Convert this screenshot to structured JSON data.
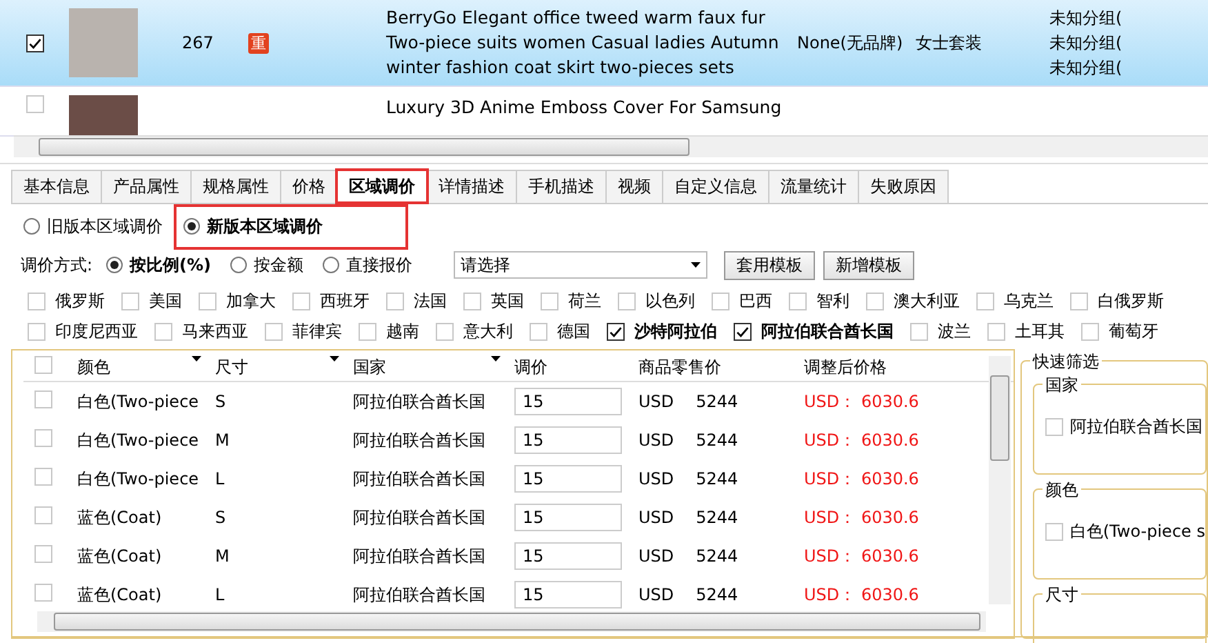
{
  "products": [
    {
      "checked": true,
      "selected": true,
      "id": "267",
      "badge": "重",
      "title": "BerryGo Elegant office tweed warm faux fur Two-piece suits women Casual ladies Autumn winter fashion coat skirt two-pieces sets",
      "brand": "None(无品牌)",
      "category": "女士套装",
      "groups": [
        "未知分组(",
        "未知分组(",
        "未知分组("
      ]
    },
    {
      "checked": false,
      "selected": false,
      "title": "Luxury 3D Anime Emboss Cover For Samsung"
    }
  ],
  "tabs": [
    {
      "label": "基本信息",
      "selected": false
    },
    {
      "label": "产品属性",
      "selected": false
    },
    {
      "label": "规格属性",
      "selected": false
    },
    {
      "label": "价格",
      "selected": false
    },
    {
      "label": "区域调价",
      "selected": true
    },
    {
      "label": "详情描述",
      "selected": false
    },
    {
      "label": "手机描述",
      "selected": false
    },
    {
      "label": "视频",
      "selected": false
    },
    {
      "label": "自定义信息",
      "selected": false
    },
    {
      "label": "流量统计",
      "selected": false
    },
    {
      "label": "失败原因",
      "selected": false
    }
  ],
  "versions": [
    {
      "label": "旧版本区域调价",
      "selected": false
    },
    {
      "label": "新版本区域调价",
      "selected": true
    }
  ],
  "method": {
    "label": "调价方式:",
    "options": [
      {
        "label": "按比例(%)",
        "selected": true
      },
      {
        "label": "按金额",
        "selected": false
      },
      {
        "label": "直接报价",
        "selected": false
      }
    ],
    "template_select": "请选择",
    "buttons": [
      "套用模板",
      "新增模板"
    ]
  },
  "countries": [
    [
      {
        "label": "俄罗斯",
        "checked": false
      },
      {
        "label": "美国",
        "checked": false
      },
      {
        "label": "加拿大",
        "checked": false
      },
      {
        "label": "西班牙",
        "checked": false
      },
      {
        "label": "法国",
        "checked": false
      },
      {
        "label": "英国",
        "checked": false
      },
      {
        "label": "荷兰",
        "checked": false
      },
      {
        "label": "以色列",
        "checked": false
      },
      {
        "label": "巴西",
        "checked": false
      },
      {
        "label": "智利",
        "checked": false
      },
      {
        "label": "澳大利亚",
        "checked": false
      },
      {
        "label": "乌克兰",
        "checked": false
      },
      {
        "label": "白俄罗斯",
        "checked": false
      }
    ],
    [
      {
        "label": "印度尼西亚",
        "checked": false
      },
      {
        "label": "马来西亚",
        "checked": false
      },
      {
        "label": "菲律宾",
        "checked": false
      },
      {
        "label": "越南",
        "checked": false
      },
      {
        "label": "意大利",
        "checked": false
      },
      {
        "label": "德国",
        "checked": false
      },
      {
        "label": "沙特阿拉伯",
        "checked": true
      },
      {
        "label": "阿拉伯联合酋长国",
        "checked": true
      },
      {
        "label": "波兰",
        "checked": false
      },
      {
        "label": "土耳其",
        "checked": false
      },
      {
        "label": "葡萄牙",
        "checked": false
      }
    ]
  ],
  "table": {
    "select_all": false,
    "columns": [
      {
        "label": "颜色",
        "filter": true
      },
      {
        "label": "尺寸",
        "filter": true
      },
      {
        "label": "国家",
        "filter": true
      },
      {
        "label": "调价",
        "filter": false
      },
      {
        "label": "商品零售价",
        "filter": false
      },
      {
        "label": "调整后价格",
        "filter": false
      }
    ],
    "rows": [
      {
        "checked": false,
        "variant": "白色(Two-piece",
        "size": "S",
        "country": "阿拉伯联合酋长国",
        "adjust": "15",
        "currency": "USD",
        "retail": "5244",
        "adjusted": "USD： 6030.6"
      },
      {
        "checked": false,
        "variant": "白色(Two-piece",
        "size": "M",
        "country": "阿拉伯联合酋长国",
        "adjust": "15",
        "currency": "USD",
        "retail": "5244",
        "adjusted": "USD： 6030.6"
      },
      {
        "checked": false,
        "variant": "白色(Two-piece",
        "size": "L",
        "country": "阿拉伯联合酋长国",
        "adjust": "15",
        "currency": "USD",
        "retail": "5244",
        "adjusted": "USD： 6030.6"
      },
      {
        "checked": false,
        "variant": "蓝色(Coat)",
        "size": "S",
        "country": "阿拉伯联合酋长国",
        "adjust": "15",
        "currency": "USD",
        "retail": "5244",
        "adjusted": "USD： 6030.6"
      },
      {
        "checked": false,
        "variant": "蓝色(Coat)",
        "size": "M",
        "country": "阿拉伯联合酋长国",
        "adjust": "15",
        "currency": "USD",
        "retail": "5244",
        "adjusted": "USD： 6030.6"
      },
      {
        "checked": false,
        "variant": "蓝色(Coat)",
        "size": "L",
        "country": "阿拉伯联合酋长国",
        "adjust": "15",
        "currency": "USD",
        "retail": "5244",
        "adjusted": "USD： 6030.6"
      }
    ]
  },
  "quick_filter": {
    "title": "快速筛选",
    "groups": [
      {
        "title": "国家",
        "options": [
          {
            "label": "阿拉伯联合酋长国",
            "checked": false
          }
        ]
      },
      {
        "title": "颜色",
        "options": [
          {
            "label": "白色(Two-piece s",
            "checked": false
          }
        ]
      },
      {
        "title": "尺寸"
      }
    ]
  }
}
